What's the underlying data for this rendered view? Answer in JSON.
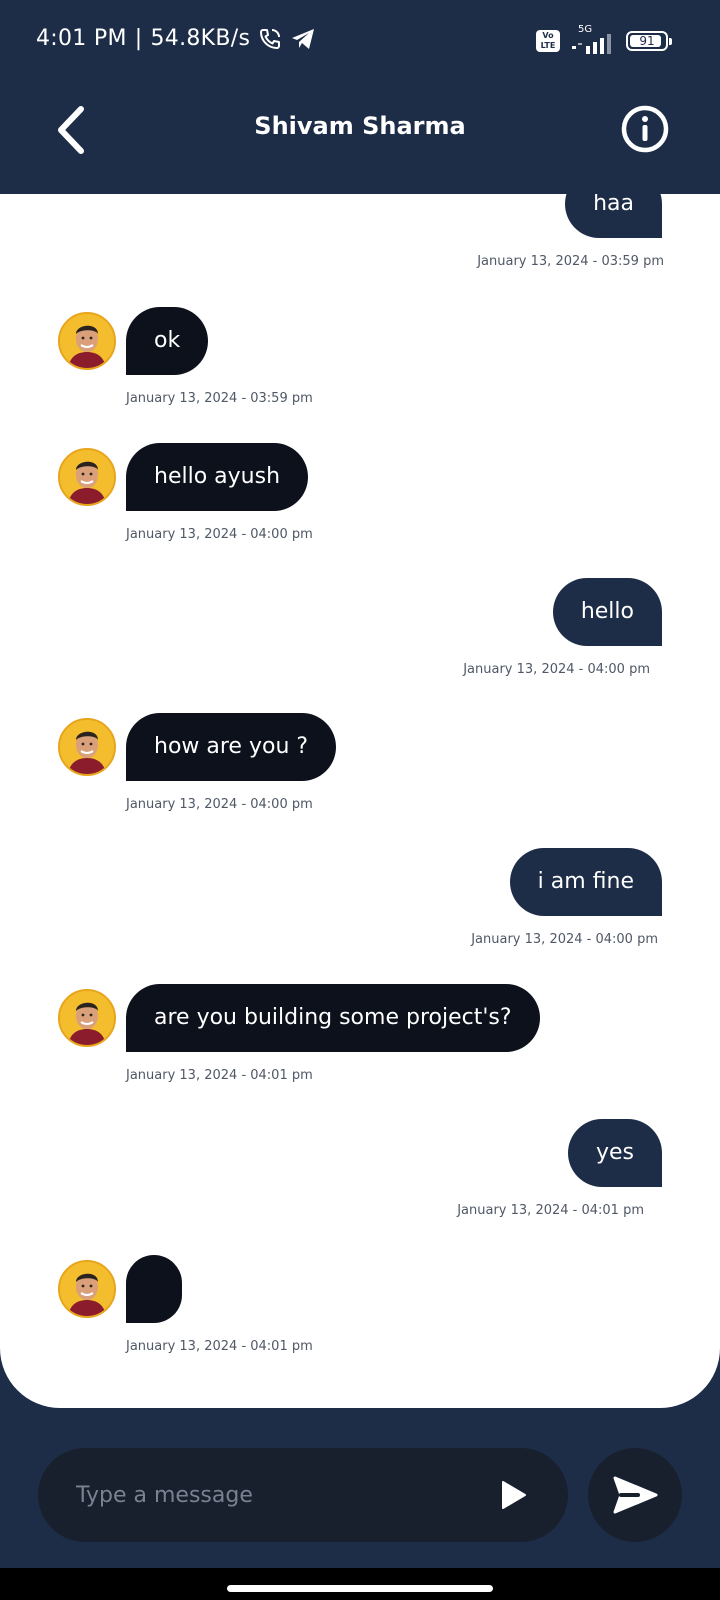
{
  "status_bar": {
    "time": "4:01 PM",
    "separator": "|",
    "speed": "54.8KB/s",
    "volte_label": "Vo LTE",
    "network_label": "5G",
    "battery_level": "91",
    "battery_fraction": 0.91
  },
  "header": {
    "title": "Shivam Sharma"
  },
  "colors": {
    "header_bg": "#1e2d47",
    "sent_bubble": "#1e2d47",
    "received_bubble": "#0c111c",
    "chat_bg": "#ffffff",
    "composer_bg": "#18202e"
  },
  "messages": [
    {
      "direction": "sent",
      "text": "haa",
      "timestamp": "January 13, 2024 - 03:59 pm"
    },
    {
      "direction": "received",
      "text": "ok",
      "timestamp": "January 13, 2024 - 03:59 pm"
    },
    {
      "direction": "received",
      "text": "hello ayush",
      "timestamp": "January 13, 2024 - 04:00 pm"
    },
    {
      "direction": "sent",
      "text": "hello",
      "timestamp": "January 13, 2024 - 04:00 pm"
    },
    {
      "direction": "received",
      "text": "how are you ?",
      "timestamp": "January 13, 2024 - 04:00 pm"
    },
    {
      "direction": "sent",
      "text": "i am fine",
      "timestamp": "January 13, 2024 - 04:00 pm"
    },
    {
      "direction": "received",
      "text": "are you building some project's?",
      "timestamp": "January 13, 2024 - 04:01 pm"
    },
    {
      "direction": "sent",
      "text": "yes",
      "timestamp": "January 13, 2024 - 04:01 pm"
    },
    {
      "direction": "received",
      "text": "",
      "timestamp": "January 13, 2024 - 04:01 pm"
    }
  ],
  "composer": {
    "placeholder": "Type a message",
    "value": ""
  },
  "icons": {
    "back": "back-arrow-icon",
    "info": "info-icon",
    "play": "play-icon",
    "send": "send-icon",
    "call": "phone-call-icon",
    "telegram": "telegram-icon"
  }
}
